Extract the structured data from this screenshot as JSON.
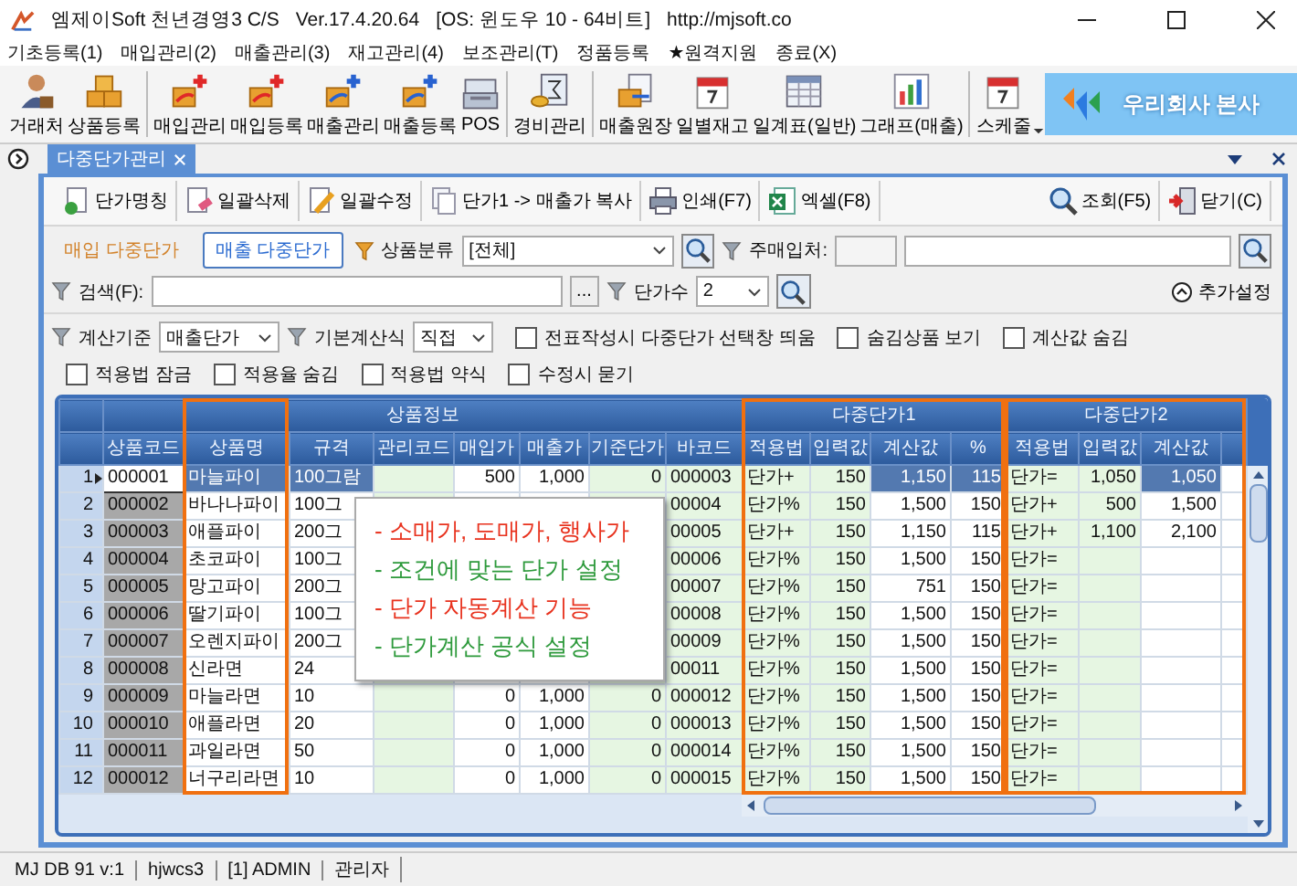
{
  "window": {
    "title": "엠제이Soft 천년경영3 C/S",
    "version": "Ver.17.4.20.64",
    "os": "[OS: 윈도우 10 - 64비트]",
    "url": "http://mjsoft.co"
  },
  "menu": [
    "기초등록(1)",
    "매입관리(2)",
    "매출관리(3)",
    "재고관리(4)",
    "보조관리(T)",
    "정품등록",
    "★원격지원",
    "종료(X)"
  ],
  "toolbar": [
    {
      "items": [
        "거래처",
        "상품등록"
      ]
    },
    {
      "items": [
        "매입관리",
        "매입등록",
        "매출관리",
        "매출등록",
        "POS"
      ]
    },
    {
      "items": [
        "경비관리"
      ]
    },
    {
      "items": [
        "매출원장",
        "일별재고",
        "일계표(일반)",
        "그래프(매출)"
      ]
    },
    {
      "items": [
        "스케줄"
      ]
    }
  ],
  "company_banner": "우리회사 본사",
  "doc_tabs": [
    {
      "label": "다중단가관리",
      "selected": true
    }
  ],
  "actions_left": [
    "단가명칭",
    "일괄삭제",
    "일괄수정",
    "단가1 -> 매출가 복사",
    "인쇄(F7)",
    "엑셀(F8)"
  ],
  "actions_right": [
    "조회(F5)",
    "닫기(C)"
  ],
  "price_tabs": [
    {
      "label": "매입 다중단가",
      "selected": false
    },
    {
      "label": "매출 다중단가",
      "selected": true
    }
  ],
  "filters": {
    "category_label": "상품분류",
    "category_value": "[전체]",
    "supplier_label": "주매입처:",
    "search_label": "검색(F):",
    "browse_button": "...",
    "price_count_label": "단가수",
    "price_count_value": "2",
    "more_settings": "추가설정",
    "calc_basis_label": "계산기준",
    "calc_basis_value": "매출단가",
    "formula_label": "기본계산식",
    "formula_value": "직접"
  },
  "options": [
    {
      "label": "전표작성시 다중단가 선택창 띄움",
      "checked": false
    },
    {
      "label": "숨김상품 보기",
      "checked": false
    },
    {
      "label": "계산값 숨김",
      "checked": false
    },
    {
      "label": "적용법 잠금",
      "checked": false
    },
    {
      "label": "적용율 숨김",
      "checked": false
    },
    {
      "label": "적용법 약식",
      "checked": false
    },
    {
      "label": "수정시 묻기",
      "checked": false
    }
  ],
  "grid": {
    "column_groups": [
      {
        "label": "상품정보",
        "columns": [
          {
            "label": "상품코드",
            "highlighted": false
          },
          {
            "label": "상품명",
            "highlighted": true
          },
          {
            "label": "규격",
            "highlighted": false
          },
          {
            "label": "관리코드",
            "highlighted": false
          },
          {
            "label": "매입가",
            "highlighted": false
          },
          {
            "label": "매출가",
            "highlighted": false
          },
          {
            "label": "기준단가",
            "highlighted": false
          },
          {
            "label": "바코드",
            "highlighted": false
          }
        ]
      },
      {
        "label": "다중단가1",
        "columns": [
          {
            "label": "적용법",
            "highlighted": true
          },
          {
            "label": "입력값",
            "highlighted": true
          },
          {
            "label": "계산값",
            "highlighted": true
          },
          {
            "label": "%",
            "highlighted": true
          }
        ]
      },
      {
        "label": "다중단가2",
        "columns": [
          {
            "label": "적용법",
            "highlighted": true
          },
          {
            "label": "입력값",
            "highlighted": true
          },
          {
            "label": "계산값",
            "highlighted": true
          }
        ]
      }
    ],
    "rows": [
      {
        "no": "1",
        "selected": true,
        "code": "000001",
        "name": "마늘파이",
        "spec": "100그람",
        "buy": "500",
        "sell": "1,000",
        "base": "0",
        "barcode": "000003",
        "m1_method": "단가+",
        "m1_input": "150",
        "m1_calc": "1,150",
        "m1_pct": "115",
        "m2_method": "단가=",
        "m2_input": "1,050",
        "m2_calc": "1,050"
      },
      {
        "no": "2",
        "selected": false,
        "code": "000002",
        "name": "바나나파이",
        "spec": "100그",
        "barcode": "00004",
        "m1_method": "단가%",
        "m1_input": "150",
        "m1_calc": "1,500",
        "m1_pct": "150",
        "m2_method": "단가+",
        "m2_input": "500",
        "m2_calc": "1,500"
      },
      {
        "no": "3",
        "selected": false,
        "code": "000003",
        "name": "애플파이",
        "spec": "200그",
        "barcode": "00005",
        "m1_method": "단가+",
        "m1_input": "150",
        "m1_calc": "1,150",
        "m1_pct": "115",
        "m2_method": "단가+",
        "m2_input": "1,100",
        "m2_calc": "2,100"
      },
      {
        "no": "4",
        "selected": false,
        "code": "000004",
        "name": "초코파이",
        "spec": "100그",
        "barcode": "00006",
        "m1_method": "단가%",
        "m1_input": "150",
        "m1_calc": "1,500",
        "m1_pct": "150",
        "m2_method": "단가="
      },
      {
        "no": "5",
        "selected": false,
        "code": "000005",
        "name": "망고파이",
        "spec": "200그",
        "barcode": "00007",
        "m1_method": "단가%",
        "m1_input": "150",
        "m1_calc": "751",
        "m1_pct": "150",
        "m2_method": "단가="
      },
      {
        "no": "6",
        "selected": false,
        "code": "000006",
        "name": "딸기파이",
        "spec": "100그",
        "barcode": "00008",
        "m1_method": "단가%",
        "m1_input": "150",
        "m1_calc": "1,500",
        "m1_pct": "150",
        "m2_method": "단가="
      },
      {
        "no": "7",
        "selected": false,
        "code": "000007",
        "name": "오렌지파이",
        "spec": "200그",
        "barcode": "00009",
        "m1_method": "단가%",
        "m1_input": "150",
        "m1_calc": "1,500",
        "m1_pct": "150",
        "m2_method": "단가="
      },
      {
        "no": "8",
        "selected": false,
        "code": "000008",
        "name": "신라면",
        "spec": "24",
        "barcode": "00011",
        "m1_method": "단가%",
        "m1_input": "150",
        "m1_calc": "1,500",
        "m1_pct": "150",
        "m2_method": "단가="
      },
      {
        "no": "9",
        "selected": false,
        "code": "000009",
        "name": "마늘라면",
        "spec": "10",
        "buy": "0",
        "sell": "1,000",
        "base": "0",
        "barcode": "000012",
        "m1_method": "단가%",
        "m1_input": "150",
        "m1_calc": "1,500",
        "m1_pct": "150",
        "m2_method": "단가="
      },
      {
        "no": "10",
        "selected": false,
        "code": "000010",
        "name": "애플라면",
        "spec": "20",
        "buy": "0",
        "sell": "1,000",
        "base": "0",
        "barcode": "000013",
        "m1_method": "단가%",
        "m1_input": "150",
        "m1_calc": "1,500",
        "m1_pct": "150",
        "m2_method": "단가="
      },
      {
        "no": "11",
        "selected": false,
        "code": "000011",
        "name": "과일라면",
        "spec": "50",
        "buy": "0",
        "sell": "1,000",
        "base": "0",
        "barcode": "000014",
        "m1_method": "단가%",
        "m1_input": "150",
        "m1_calc": "1,500",
        "m1_pct": "150",
        "m2_method": "단가="
      },
      {
        "no": "12",
        "selected": false,
        "code": "000012",
        "name": "너구리라면",
        "spec": "10",
        "buy": "0",
        "sell": "1,000",
        "base": "0",
        "barcode": "000015",
        "m1_method": "단가%",
        "m1_input": "150",
        "m1_calc": "1,500",
        "m1_pct": "150",
        "m2_method": "단가="
      }
    ]
  },
  "callout": {
    "lines": [
      {
        "text": "- 소매가, 도매가, 행사가",
        "color": "#e8321e"
      },
      {
        "text": "- 조건에 맞는 단가 설정",
        "color": "#2e9a3c"
      },
      {
        "text": "- 단가 자동계산 기능",
        "color": "#e8321e"
      },
      {
        "text": "- 단가계산 공식 설정",
        "color": "#2e9a3c"
      }
    ]
  },
  "status_bar": [
    "MJ DB 91 v:1",
    "hjwcs3",
    "[1] ADMIN",
    "관리자"
  ]
}
